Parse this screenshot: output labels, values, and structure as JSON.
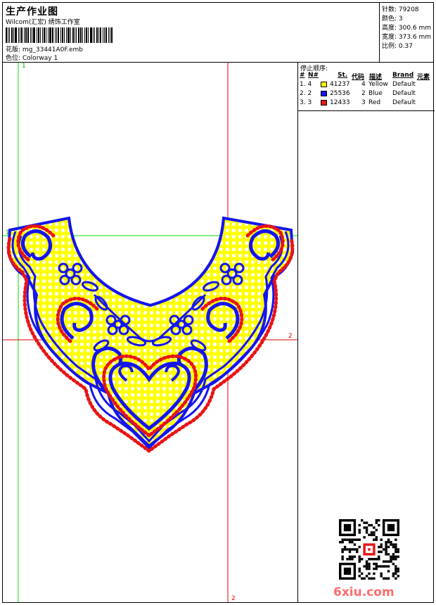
{
  "header": {
    "title": "生产作业图",
    "subtitle": "Wilcom(汇宏) 绣饰工作室",
    "design_label": "花版: mg_33441A0F.emb",
    "colorway_label": "色位: Colorway 1"
  },
  "stats": {
    "stitches": "针数: 79208",
    "colors": "颜色: 3",
    "height": "高度: 300.6 mm",
    "width": "宽度: 373.6 mm",
    "scale": "比例: 0.37"
  },
  "stop_sequence": {
    "title": "停止顺序:",
    "headers": [
      "#",
      "N#",
      "St.",
      "代码",
      "描述",
      "Brand",
      "元素"
    ],
    "rows": [
      {
        "seq": "1. 4",
        "color": "#ffff00",
        "stitches": "41237",
        "code": "4",
        "description": "Yellow",
        "brand": "Default"
      },
      {
        "seq": "2. 2",
        "color": "#1515ee",
        "stitches": "25536",
        "code": "2",
        "description": "Blue",
        "brand": "Default"
      },
      {
        "seq": "3. 3",
        "color": "#e81414",
        "stitches": "12433",
        "code": "3",
        "description": "Red",
        "brand": "Default"
      }
    ]
  },
  "guides": {
    "v1_label": "1",
    "h1_label": "1",
    "h2_label": "2",
    "v2_label": "2"
  },
  "watermark": "6xiu.com",
  "colors": {
    "yellow": "#ffff00",
    "blue": "#1515ee",
    "red": "#e81414",
    "guide_green": "#00dd00",
    "guide_red": "#dd0000"
  }
}
